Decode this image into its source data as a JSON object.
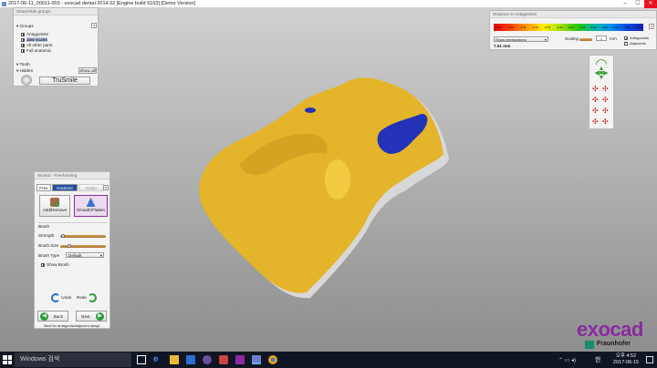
{
  "titlebar": {
    "title": "2017-06-11_00011-003 - exocad dental 2014.02 [Engine build 5163] [Demo Version]",
    "minimize": "–",
    "maximize": "☐",
    "close": "✕"
  },
  "show_hide_groups": {
    "title": "Show/Hide groups",
    "groups_header": "Groups",
    "help": "?",
    "items": [
      {
        "label": "Antagonists",
        "checked": true
      },
      {
        "label": "Jaw scans",
        "checked": true
      },
      {
        "label": "All other parts",
        "checked": true
      },
      {
        "label": "Full anatomic",
        "checked": true
      }
    ],
    "tooth_label": "Tooth",
    "hidden_label": "Hidden",
    "show_all": "Show all",
    "trusmile": "TruSmile"
  },
  "distance_panel": {
    "title": "Distance to Antagonists",
    "scale_labels": [
      "-0.61",
      "-0.51",
      "-0.41",
      "-0.31",
      "-0.21",
      "-0.11",
      "0.01",
      "0.11",
      "0.21",
      "0.31",
      "0.41",
      "0.51",
      "0.61"
    ],
    "dropdown": "Show intersections",
    "scaling_label": "Scaling",
    "scaling_value": "1",
    "scaling_unit": "mm",
    "distance_value": "7.61 mm",
    "antagonists_label": "Antagonists",
    "adjacents_label": "Adjacents",
    "help": "?"
  },
  "wizard": {
    "title": "Wizard - Freeforming",
    "tabs": [
      "Free",
      "Anatomic",
      "Bottle"
    ],
    "help": "?",
    "add_remove": "Add/Remove",
    "smooth_flatten": "Smooth/Flatten",
    "brush_header": "Brush",
    "strength_label": "Strength",
    "brush_size_label": "Brush Size",
    "brush_type_label": "Brush Type",
    "brush_type_value": "Default",
    "strength_level": 0.02,
    "brush_size_level": 0.18,
    "show_brush": "Show Brush",
    "undo": "Undo",
    "redo": "Redo",
    "back": "Back",
    "next": "Next",
    "status": "Next for antagonist/adjacent adapt"
  },
  "logo": {
    "brand": "exocad",
    "sub": "Fraunhofer"
  },
  "taskbar": {
    "search": "Windows 검색",
    "ime": "한",
    "time": "오후 4:52",
    "date": "2017-06-15"
  },
  "colors": {
    "tooth": "#e4b52a",
    "contact": "#2233b8",
    "accent": "#8a2aa0"
  }
}
